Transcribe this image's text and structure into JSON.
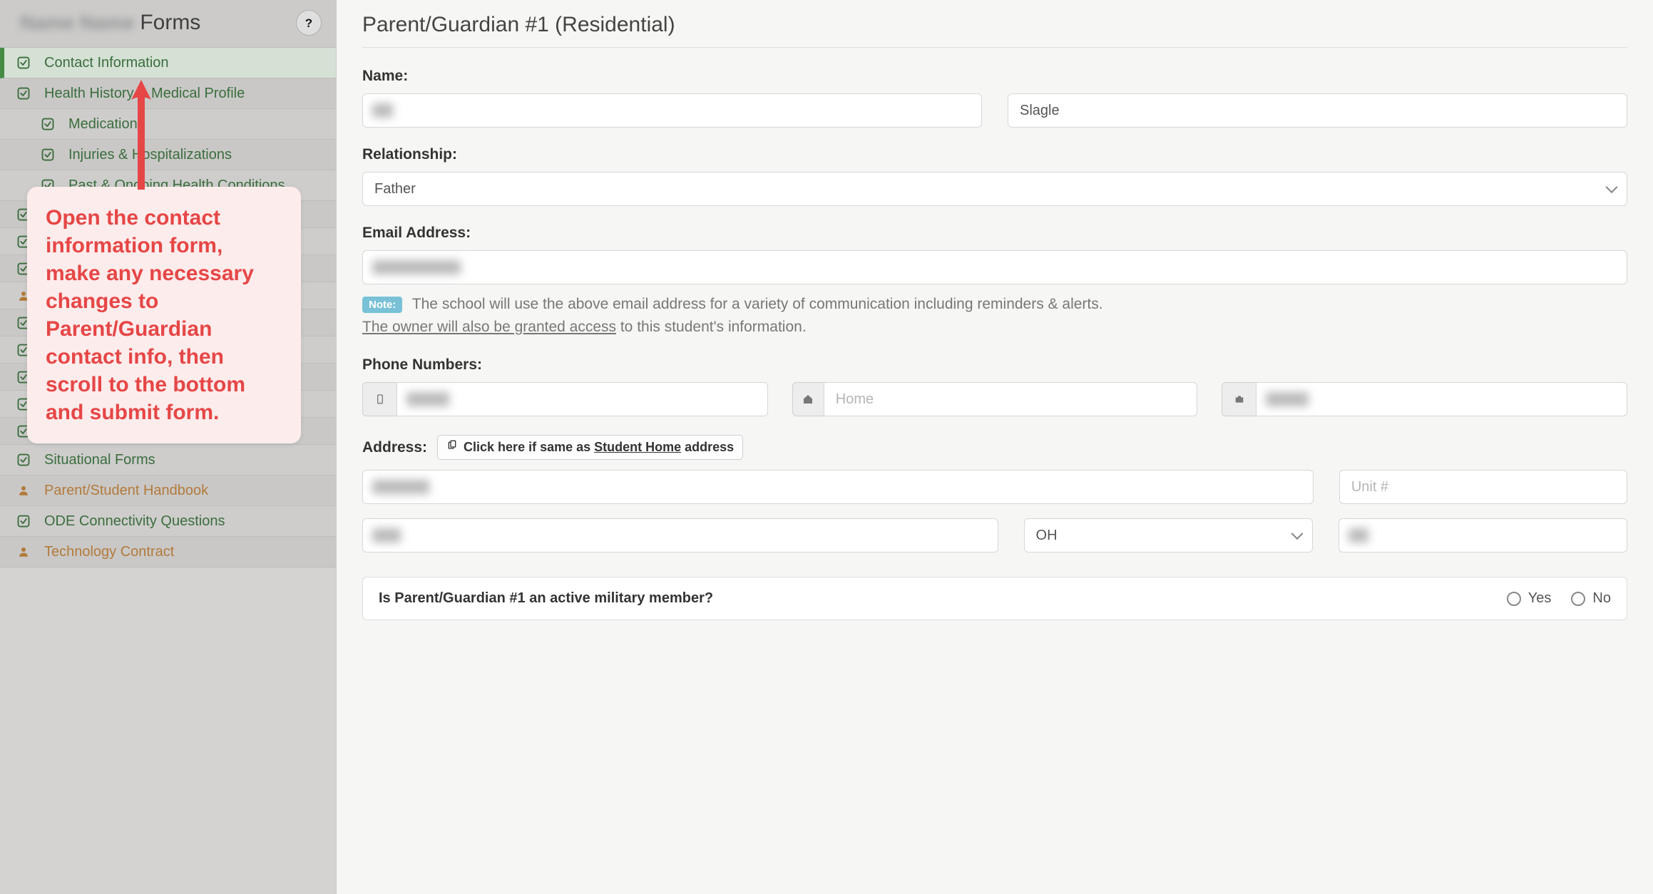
{
  "sidebar": {
    "title": "Forms",
    "help": "?",
    "items": [
      {
        "label": "Contact Information",
        "active": true,
        "icon": "check",
        "indent": false
      },
      {
        "label": "Health History & Medical Profile",
        "active": false,
        "icon": "check",
        "indent": false
      },
      {
        "label": "Medications",
        "active": false,
        "icon": "check",
        "indent": true
      },
      {
        "label": "Injuries & Hospitalizations",
        "active": false,
        "icon": "check",
        "indent": true
      },
      {
        "label": "Past & Ongoing Health Conditions",
        "active": false,
        "icon": "check",
        "indent": true
      },
      {
        "label": "",
        "active": false,
        "icon": "check",
        "indent": false
      },
      {
        "label": "",
        "active": false,
        "icon": "check",
        "indent": false
      },
      {
        "label": "",
        "active": false,
        "icon": "check",
        "indent": false
      },
      {
        "label": "",
        "active": false,
        "icon": "person",
        "indent": false
      },
      {
        "label": "",
        "active": false,
        "icon": "check",
        "indent": false
      },
      {
        "label": "",
        "active": false,
        "icon": "check",
        "indent": false
      },
      {
        "label": "",
        "active": false,
        "icon": "check",
        "indent": false
      },
      {
        "label": "",
        "active": false,
        "icon": "check",
        "indent": false
      },
      {
        "label": "",
        "active": false,
        "icon": "check",
        "indent": false
      },
      {
        "label": "Situational Forms",
        "active": false,
        "icon": "check",
        "indent": false
      },
      {
        "label": "Parent/Student Handbook",
        "active": false,
        "icon": "person",
        "indent": false
      },
      {
        "label": "ODE Connectivity Questions",
        "active": false,
        "icon": "check",
        "indent": false
      },
      {
        "label": "Technology Contract",
        "active": false,
        "icon": "person",
        "indent": false
      }
    ]
  },
  "callout": "Open the contact information form, make any necessary changes to Parent/Guardian contact info, then scroll to the bottom and submit form.",
  "main": {
    "title": "Parent/Guardian #1 (Residential)",
    "name_label": "Name:",
    "first_name": "",
    "last_name": "Slagle",
    "relationship_label": "Relationship:",
    "relationship_value": "Father",
    "email_label": "Email Address:",
    "email_value": "",
    "note_badge": "Note:",
    "note_text_1": "The school will use the above email address for a variety of communication including reminders & alerts.",
    "note_link": "The owner will also be granted access",
    "note_text_2": " to this student's information.",
    "phone_label": "Phone Numbers:",
    "phone_mobile": "",
    "phone_home_placeholder": "Home",
    "phone_work": "",
    "address_label": "Address:",
    "copy_button_pre": "Click here if same as ",
    "copy_button_u": "Student Home",
    "copy_button_post": " address",
    "street": "",
    "unit_placeholder": "Unit #",
    "city": "",
    "state": "OH",
    "zip": "",
    "military_q": "Is Parent/Guardian #1 an active military member?",
    "military_yes": "Yes",
    "military_no": "No"
  }
}
